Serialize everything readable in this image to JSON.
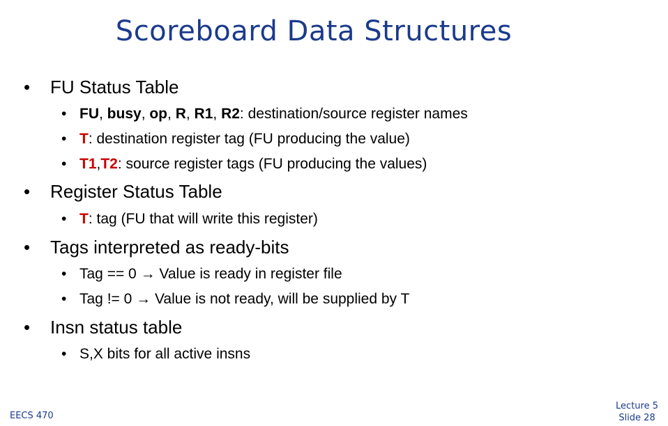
{
  "title": "Scoreboard Data Structures",
  "bullets": [
    {
      "text": "FU Status Table",
      "sub": [
        {
          "bold": "FU",
          "sep1": ", ",
          "bold2": "busy",
          "sep2": ", ",
          "bold3": "op",
          "sep3": ", ",
          "bold4": "R",
          "sep4": ", ",
          "bold5": "R1",
          "sep5": ", ",
          "bold6": "R2",
          "rest": ": destination/source register names"
        },
        {
          "red": "T",
          "rest": ": destination register tag (FU producing the value)"
        },
        {
          "red": "T1",
          "sep": ",",
          "red2": "T2",
          "rest": ": source register tags (FU producing the values)"
        }
      ]
    },
    {
      "text": "Register Status Table",
      "sub": [
        {
          "red": "T",
          "rest": ": tag (FU that will write this register)"
        }
      ]
    },
    {
      "text": "Tags interpreted as ready-bits",
      "sub": [
        {
          "text": "Tag == 0 → Value is ready in register file"
        },
        {
          "text": "Tag != 0 → Value is not ready, will be supplied by T"
        }
      ]
    },
    {
      "text": "Insn status table",
      "sub": [
        {
          "text": "S,X bits for all active insns"
        }
      ]
    }
  ],
  "footer": {
    "course": "EECS 470",
    "lecture": "Lecture 5",
    "slide": "Slide 28"
  }
}
